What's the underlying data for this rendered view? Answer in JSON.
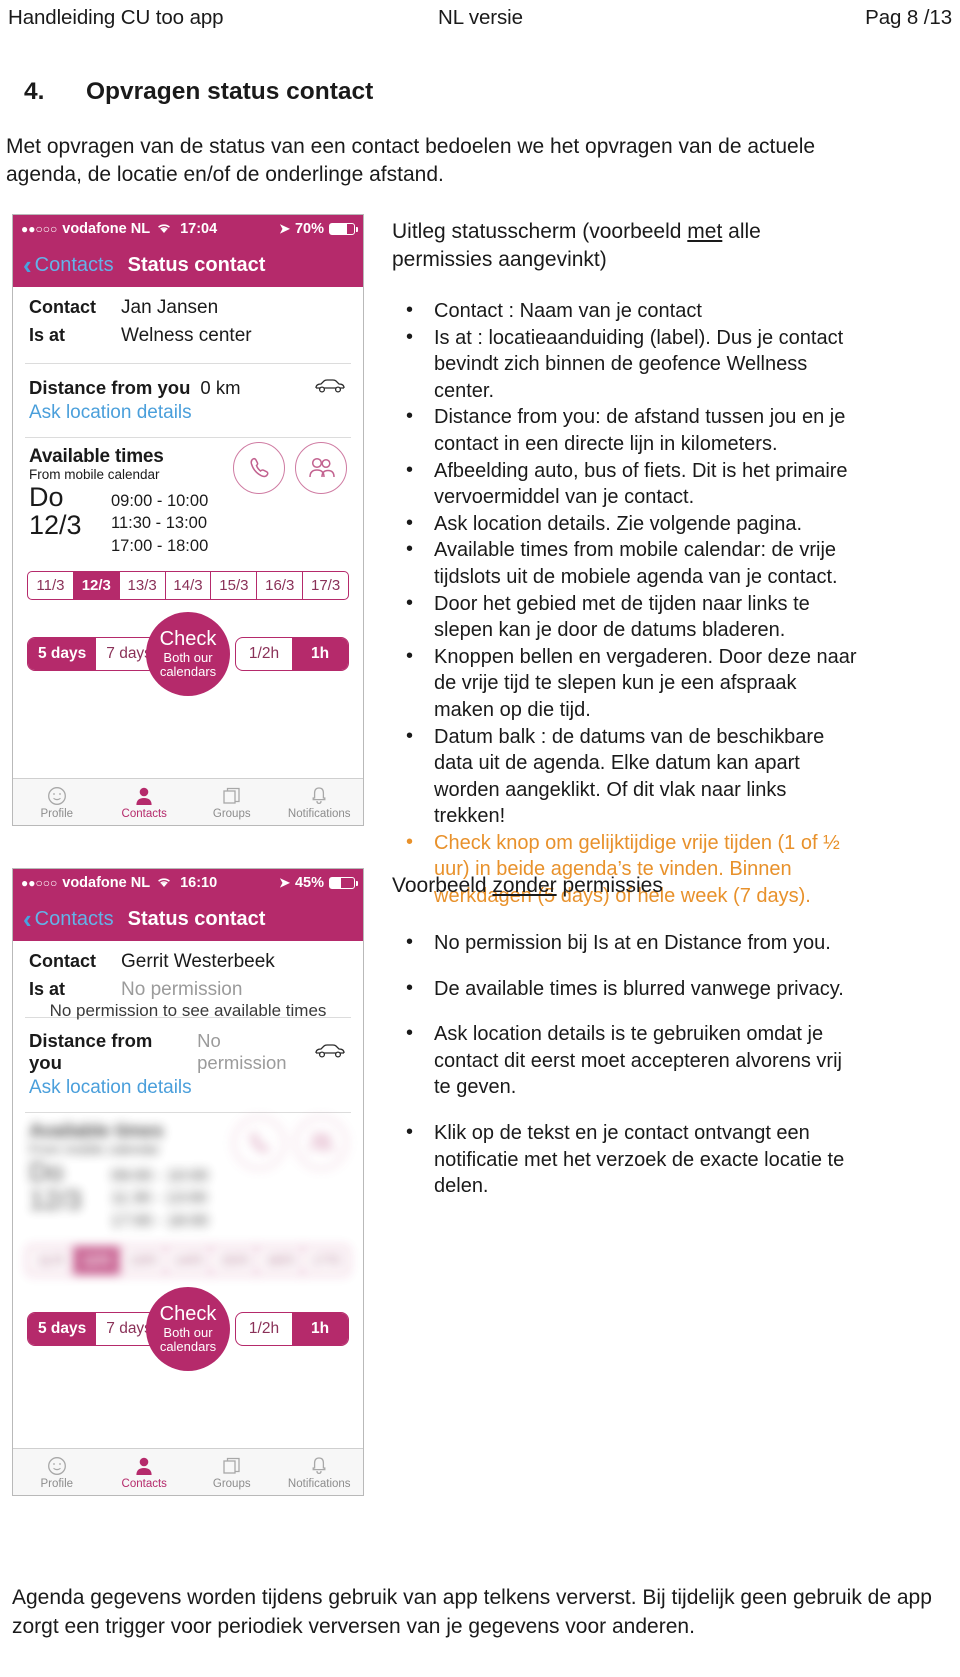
{
  "header": {
    "left": "Handleiding CU too app",
    "center": "NL versie",
    "right": "Pag 8 /13"
  },
  "section": {
    "number": "4.",
    "title": "Opvragen status contact",
    "intro": "Met opvragen van de status van een contact bedoelen we het opvragen van de actuele agenda, de locatie en/of de onderlinge afstand."
  },
  "phone1": {
    "status": {
      "dots": "●●○○○",
      "carrier": "vodafone NL",
      "wifi_icon": "wifi-icon",
      "time": "17:04",
      "location_icon": "location-arrow-icon",
      "battery_pct": "70%",
      "battery_level": 70
    },
    "nav": {
      "back_icon": "chevron-left-icon",
      "back_label": "Contacts",
      "title": "Status contact"
    },
    "fields": [
      {
        "label": "Contact",
        "value": "Jan Jansen"
      },
      {
        "label": "Is at",
        "value": "Welness center"
      }
    ],
    "distance": {
      "label": "Distance from you",
      "value": "0 km",
      "transport_icon": "car-icon"
    },
    "ask_link": "Ask location details",
    "available": {
      "title": "Available times",
      "subtitle": "From mobile calendar",
      "day_of_week": "Do",
      "day_date": "12/3",
      "slots": [
        "09:00 - 10:00",
        "11:30 - 13:00",
        "17:00 - 18:00"
      ],
      "call_icon": "phone-icon",
      "meet_icon": "people-icon"
    },
    "dates": [
      "11/3",
      "12/3",
      "13/3",
      "14/3",
      "15/3",
      "16/3",
      "17/3"
    ],
    "selected_date": "12/3",
    "days_segment": {
      "options": [
        "5 days",
        "7 days"
      ],
      "selected": "5 days"
    },
    "duration_segment": {
      "options": [
        "1/2h",
        "1h"
      ],
      "selected": "1h"
    },
    "check_button": {
      "line1": "Check",
      "line2": "Both our",
      "line3": "calendars"
    },
    "tabs": [
      {
        "label": "Profile",
        "icon": "smiley-icon",
        "active": false
      },
      {
        "label": "Contacts",
        "icon": "person-icon",
        "active": true
      },
      {
        "label": "Groups",
        "icon": "cards-icon",
        "active": false
      },
      {
        "label": "Notifications",
        "icon": "bell-icon",
        "active": false
      }
    ]
  },
  "phone2": {
    "status": {
      "dots": "●●○○○",
      "carrier": "vodafone NL",
      "wifi_icon": "wifi-icon",
      "time": "16:10",
      "location_icon": "location-arrow-icon",
      "battery_pct": "45%",
      "battery_level": 45
    },
    "nav": {
      "back_icon": "chevron-left-icon",
      "back_label": "Contacts",
      "title": "Status contact"
    },
    "fields": [
      {
        "label": "Contact",
        "value": "Gerrit Westerbeek"
      },
      {
        "label": "Is at",
        "value": "No permission"
      }
    ],
    "distance": {
      "label": "Distance from you",
      "value": "No permission",
      "transport_icon": "car-icon"
    },
    "ask_link": "Ask location details",
    "blur_notice": "No permission to see available times",
    "available": {
      "title": "Available times",
      "subtitle": "From mobile calendar",
      "day_of_week": "Do",
      "day_date": "12/3",
      "slots": [
        "09:00 - 10:00",
        "11:30 - 13:00",
        "17:00 - 18:00"
      ]
    },
    "dates": [
      "11/3",
      "12/3",
      "13/3",
      "14/3",
      "15/3",
      "16/3",
      "17/3"
    ],
    "selected_date": "12/3",
    "days_segment": {
      "options": [
        "5 days",
        "7 days"
      ],
      "selected": "5 days"
    },
    "duration_segment": {
      "options": [
        "1/2h",
        "1h"
      ],
      "selected": "1h"
    },
    "check_button": {
      "line1": "Check",
      "line2": "Both our",
      "line3": "calendars"
    },
    "tabs": [
      {
        "label": "Profile",
        "icon": "smiley-icon",
        "active": false
      },
      {
        "label": "Contacts",
        "icon": "person-icon",
        "active": true
      },
      {
        "label": "Groups",
        "icon": "cards-icon",
        "active": false
      },
      {
        "label": "Notifications",
        "icon": "bell-icon",
        "active": false
      }
    ]
  },
  "explain": {
    "heading_a": "Uitleg statusscherm (voorbeeld ",
    "heading_underline": "met",
    "heading_b": " alle permissies aangevinkt)",
    "bullets": [
      "Contact : Naam van je contact",
      "Is at : locatieaanduiding (label). Dus je contact bevindt zich binnen de geofence Wellness center.",
      "Distance from you: de afstand tussen jou en je contact in een directe lijn in kilometers.",
      "Afbeelding auto, bus of fiets. Dit is het primaire vervoermiddel van je contact.",
      "Ask location details. Zie volgende pagina.",
      "Available times from mobile calendar: de vrije tijdslots uit de mobiele agenda van je contact.",
      "Door het gebied met de tijden naar links te slepen kan je door de datums bladeren.",
      "Knoppen bellen en vergaderen. Door deze naar de vrije tijd te slepen kun je een afspraak maken op die tijd.",
      "Datum balk : de datums van de beschikbare data uit de agenda. Elke datum kan apart worden aangeklikt. Of dit vlak naar links trekken!"
    ],
    "highlight_bullet": "Check knop om gelijktijdige vrije tijden (1 of ½ uur) in beide agenda’s te vinden. Binnen werkdagen (5 days) of hele week (7 days).",
    "highlight_color": "#e8912b"
  },
  "no_perm": {
    "heading_a": "Voorbeeld ",
    "heading_underline": "zonder",
    "heading_b": " permissies",
    "bullets": [
      "No permission bij Is at en Distance from you.",
      "De available times is blurred vanwege privacy.",
      "Ask location details is te gebruiken omdat je contact dit eerst moet accepteren alvorens vrij te geven.",
      "Klik op de tekst en je contact ontvangt een notificatie met het verzoek de exacte locatie te delen."
    ]
  },
  "footer": "Agenda gegevens worden tijdens gebruik van app telkens ververst. Bij tijdelijk geen gebruik de app zorgt een trigger voor periodiek verversen van je gegevens voor anderen."
}
